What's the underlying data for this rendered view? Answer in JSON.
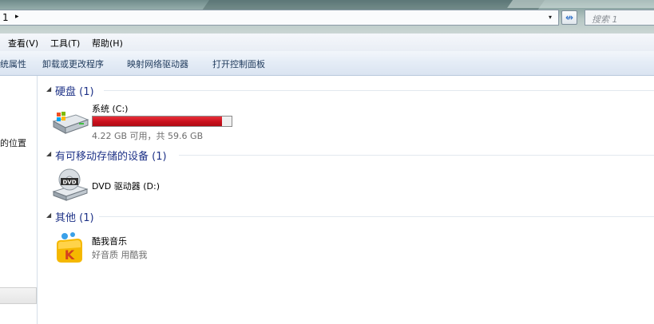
{
  "address": {
    "path": "1",
    "arrow": "▸",
    "dropdown": "▾"
  },
  "refresh_glyph": "↮",
  "search": {
    "placeholder": "搜索 1"
  },
  "menu": [
    "查看(V)",
    "工具(T)",
    "帮助(H)"
  ],
  "commands": [
    "统属性",
    "卸载或更改程序",
    "映射网络驱动器",
    "打开控制面板"
  ],
  "nav": {
    "location_label": "的位置"
  },
  "groups": [
    {
      "title": "硬盘 (1)"
    },
    {
      "title": "有可移动存储的设备 (1)"
    },
    {
      "title": "其他 (1)"
    }
  ],
  "drive_c": {
    "name": "系统 (C:)",
    "free_text": "4.22 GB 可用，共 59.6 GB",
    "used_fraction": 0.929
  },
  "drive_d": {
    "name": "DVD 驱动器 (D:)",
    "icon_label": "DVD"
  },
  "kuwo": {
    "name": "酷我音乐",
    "desc": "好音质 用酷我",
    "icon_letter": "K"
  },
  "colors": {
    "usage_bar": "#d0111c",
    "group_title": "#1e3287",
    "command_text": "#1e395b"
  }
}
